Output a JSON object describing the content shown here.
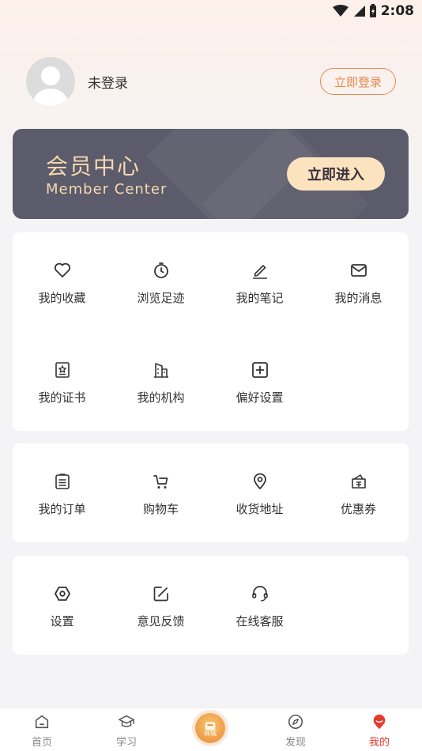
{
  "status_bar": {
    "time": "2:08"
  },
  "profile": {
    "name": "未登录",
    "login_button": "立即登录"
  },
  "member": {
    "title": "会员中心",
    "subtitle": "Member Center",
    "enter_button": "立即进入"
  },
  "section1": {
    "items": [
      {
        "label": "我的收藏",
        "icon": "heart-icon"
      },
      {
        "label": "浏览足迹",
        "icon": "clock-icon"
      },
      {
        "label": "我的笔记",
        "icon": "pencil-icon"
      },
      {
        "label": "我的消息",
        "icon": "mail-icon"
      },
      {
        "label": "我的证书",
        "icon": "certificate-icon"
      },
      {
        "label": "我的机构",
        "icon": "building-icon"
      },
      {
        "label": "偏好设置",
        "icon": "plus-square-icon"
      }
    ]
  },
  "section2": {
    "items": [
      {
        "label": "我的订单",
        "icon": "order-list-icon"
      },
      {
        "label": "购物车",
        "icon": "cart-icon"
      },
      {
        "label": "收货地址",
        "icon": "location-icon"
      },
      {
        "label": "优惠券",
        "icon": "coupon-icon"
      }
    ]
  },
  "section3": {
    "items": [
      {
        "label": "设置",
        "icon": "settings-hex-icon"
      },
      {
        "label": "意见反馈",
        "icon": "edit-icon"
      },
      {
        "label": "在线客服",
        "icon": "headset-icon"
      }
    ]
  },
  "tabbar": {
    "items": [
      {
        "label": "首页",
        "icon": "home-icon"
      },
      {
        "label": "学习",
        "icon": "graduation-cap-icon"
      },
      {
        "label": "商城",
        "icon": "shop-icon"
      },
      {
        "label": "发现",
        "icon": "compass-icon"
      },
      {
        "label": "我的",
        "icon": "profile-icon"
      }
    ]
  },
  "colors": {
    "accent": "#e8884e",
    "tab_active": "#e53b2f",
    "member_bg": "#5c5b6b",
    "member_text": "#f6d9ae",
    "member_button_bg": "#fbe3bf"
  }
}
